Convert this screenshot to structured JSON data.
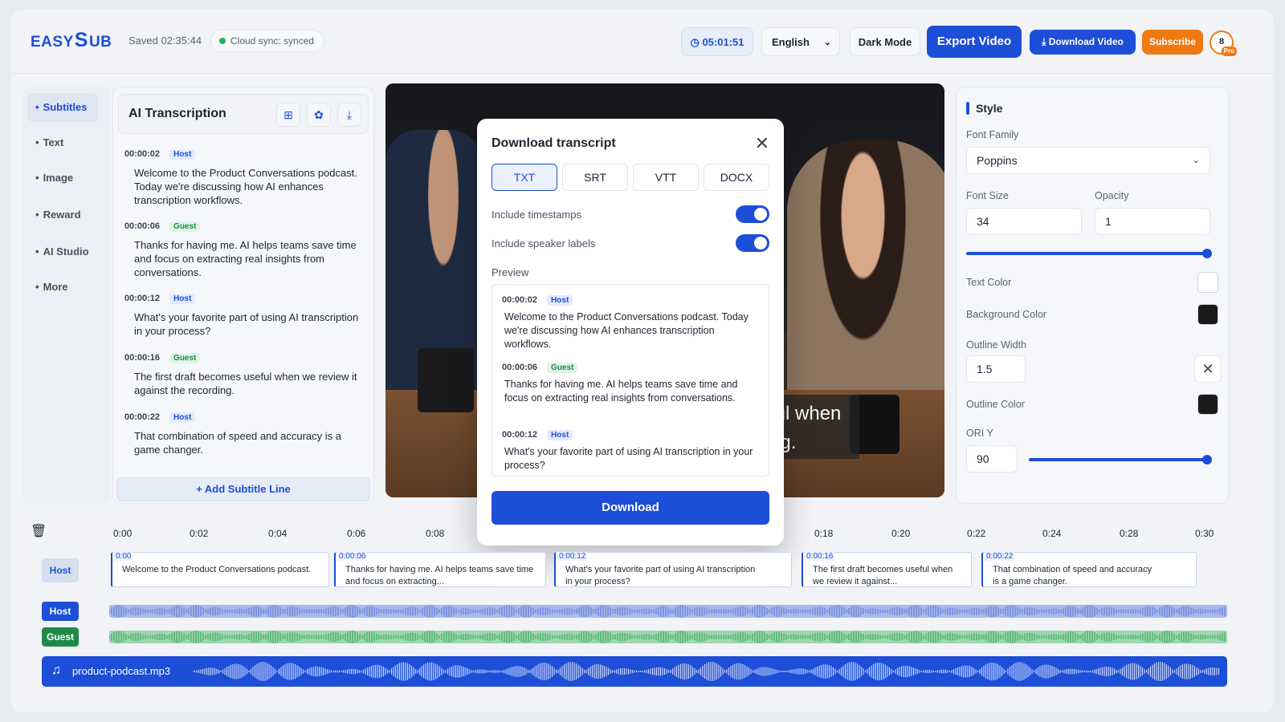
{
  "header": {
    "logo_left": "EASY",
    "logo_mark": "S",
    "logo_right": "UB",
    "saved": "Saved 02:35:44",
    "sync": "Cloud sync: synced",
    "timer": "05:01:51",
    "language": "English",
    "dark_mode": "Dark Mode",
    "export": "Export Video",
    "download_video": "Download Video",
    "subscribe": "Subscribe",
    "avatar": "8",
    "badge": "Pro"
  },
  "nav": {
    "items": [
      "Subtitles",
      "Text",
      "Image",
      "Reward",
      "AI Studio",
      "More"
    ]
  },
  "transcript": {
    "title": "AI Transcription",
    "add_line": "+ Add Subtitle Line",
    "entries": [
      {
        "time": "00:00:02",
        "speaker": "Host",
        "text": "Welcome to the Product Conversations podcast. Today we're discussing how AI enhances transcription workflows."
      },
      {
        "time": "00:00:06",
        "speaker": "Guest",
        "text": "Thanks for having me. AI helps teams save time and focus on extracting real insights from conversations."
      },
      {
        "time": "00:00:12",
        "speaker": "Host",
        "text": "What's your favorite part of using AI transcription in your process?"
      },
      {
        "time": "00:00:16",
        "speaker": "Guest",
        "text": "The first draft becomes useful when we review it against the recording."
      },
      {
        "time": "00:00:22",
        "speaker": "Host",
        "text": "That combination of speed and accuracy is a game changer."
      }
    ]
  },
  "video": {
    "caption_line1": "ful when",
    "caption_line2": "ng."
  },
  "modal": {
    "title": "Download transcript",
    "formats": [
      "TXT",
      "SRT",
      "VTT",
      "DOCX"
    ],
    "active_format": "TXT",
    "include_timestamps": "Include timestamps",
    "include_speakers": "Include speaker labels",
    "timestamps_on": true,
    "speakers_on": true,
    "preview_label": "Preview",
    "preview": [
      {
        "time": "00:00:02",
        "speaker": "Host",
        "text": "Welcome to the Product Conversations podcast. Today we're discussing how AI enhances transcription workflows."
      },
      {
        "time": "00:00:06",
        "speaker": "Guest",
        "text": "Thanks for having me. AI helps teams save time and focus on extracting real insights from conversations."
      },
      {
        "time": "00:00:12",
        "speaker": "Host",
        "text": "What's your favorite part of using AI transcription in your process?"
      }
    ],
    "download": "Download"
  },
  "style": {
    "title": "Style",
    "font_family_label": "Font Family",
    "font_family": "Poppins",
    "font_size_label": "Font Size",
    "font_size": "34",
    "opacity_label": "Opacity",
    "opacity": "1",
    "text_color_label": "Text Color",
    "text_color": "#ffffff",
    "bg_color_label": "Background Color",
    "bg_color": "#1a1a1a",
    "outline_width_label": "Outline Width",
    "outline_width": "1.5",
    "outline_color_label": "Outline Color",
    "outline_color": "#1a1a1a",
    "ori_y_label": "ORI Y",
    "ori_y": "90",
    "font_size_slider_level": 1.0,
    "ori_y_slider_level": 1.0
  },
  "timeline": {
    "ticks": [
      "0:00",
      "0:02",
      "0:04",
      "0:06",
      "0:08",
      "0:18",
      "0:20",
      "0:22",
      "0:24",
      "0:28",
      "0:30"
    ],
    "subtitle_track": "Host",
    "host_track": "Host",
    "guest_track": "Guest",
    "clips": [
      {
        "time": "0:00",
        "text": "Welcome to the Product Conversations podcast."
      },
      {
        "time": "0:00:06",
        "text": "Thanks for having me. AI helps teams save time and focus on extracting..."
      },
      {
        "time": "0:00:12",
        "text": "What's your favorite part of using AI transcription in your process?"
      },
      {
        "time": "0:00:16",
        "text": "The first draft becomes useful when we review it against..."
      },
      {
        "time": "0:00:22",
        "text": "That combination of speed and accuracy is a game changer."
      }
    ],
    "audio_file": "product-podcast.mp3"
  },
  "colors": {
    "accent": "#1d4ed8",
    "subscribe": "#ef7a12",
    "host_wave": "#a9b9ec",
    "guest_wave": "#9fd6b0"
  }
}
